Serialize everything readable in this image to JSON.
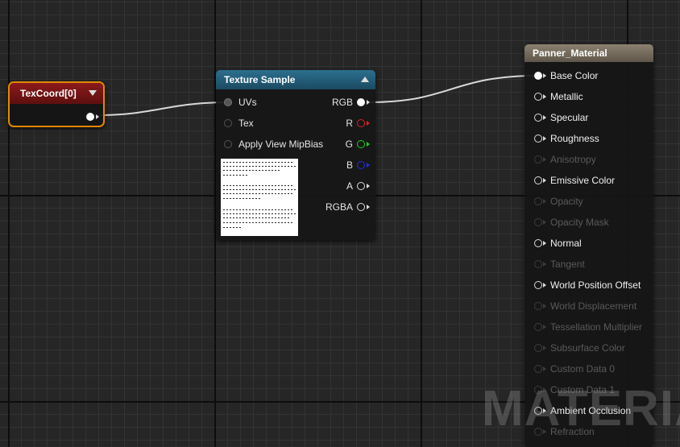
{
  "canvas": {
    "background": "#262626",
    "watermark": "MATERIAL"
  },
  "texcoord_node": {
    "title": "TexCoord[0]",
    "accent": "#e08a00"
  },
  "texture_sample_node": {
    "title": "Texture Sample",
    "inputs": [
      "UVs",
      "Tex",
      "Apply View MipBias"
    ],
    "outputs": [
      "RGB",
      "R",
      "G",
      "B",
      "A",
      "RGBA"
    ],
    "colors": {
      "R": "#e02020",
      "G": "#20d020",
      "B": "#2030e0"
    }
  },
  "material_node": {
    "title": "Panner_Material",
    "pins": [
      {
        "label": "Base Color",
        "active": true,
        "connected": true
      },
      {
        "label": "Metallic",
        "active": true
      },
      {
        "label": "Specular",
        "active": true
      },
      {
        "label": "Roughness",
        "active": true
      },
      {
        "label": "Anisotropy",
        "active": false
      },
      {
        "label": "Emissive Color",
        "active": true
      },
      {
        "label": "Opacity",
        "active": false
      },
      {
        "label": "Opacity Mask",
        "active": false
      },
      {
        "label": "Normal",
        "active": true
      },
      {
        "label": "Tangent",
        "active": false
      },
      {
        "label": "World Position Offset",
        "active": true
      },
      {
        "label": "World Displacement",
        "active": false
      },
      {
        "label": "Tessellation Multiplier",
        "active": false
      },
      {
        "label": "Subsurface Color",
        "active": false
      },
      {
        "label": "Custom Data 0",
        "active": false
      },
      {
        "label": "Custom Data 1",
        "active": false
      },
      {
        "label": "Ambient Occlusion",
        "active": true
      },
      {
        "label": "Refraction",
        "active": false
      }
    ]
  }
}
